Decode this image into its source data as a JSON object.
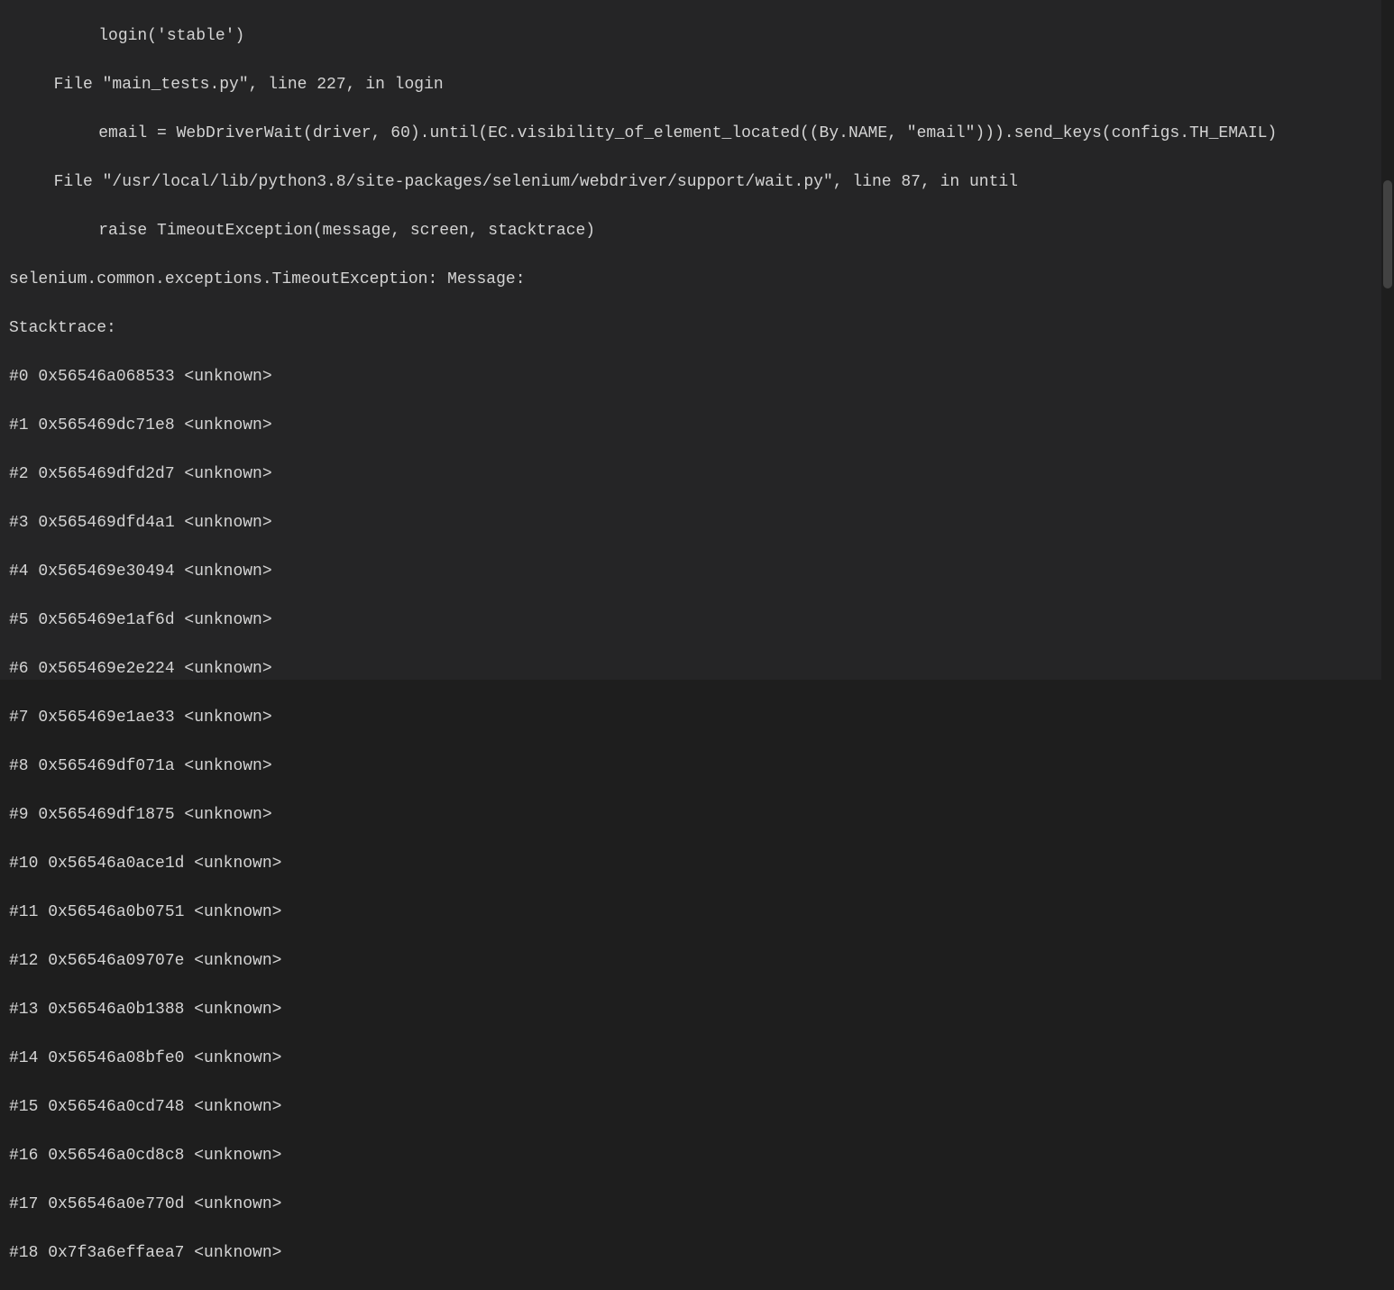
{
  "traceback": {
    "line0": "    login('stable')",
    "line1": "  File \"main_tests.py\", line 227, in login",
    "line2": "    email = WebDriverWait(driver, 60).until(EC.visibility_of_element_located((By.NAME, \"email\"))).send_keys(configs.TH_EMAIL)",
    "line3": "  File \"/usr/local/lib/python3.8/site-packages/selenium/webdriver/support/wait.py\", line 87, in until",
    "line4": "    raise TimeoutException(message, screen, stacktrace)",
    "line5": "selenium.common.exceptions.TimeoutException: Message:",
    "line6": "Stacktrace:",
    "frames": [
      "#0 0x56546a068533 <unknown>",
      "#1 0x565469dc71e8 <unknown>",
      "#2 0x565469dfd2d7 <unknown>",
      "#3 0x565469dfd4a1 <unknown>",
      "#4 0x565469e30494 <unknown>",
      "#5 0x565469e1af6d <unknown>",
      "#6 0x565469e2e224 <unknown>",
      "#7 0x565469e1ae33 <unknown>",
      "#8 0x565469df071a <unknown>",
      "#9 0x565469df1875 <unknown>",
      "#10 0x56546a0ace1d <unknown>",
      "#11 0x56546a0b0751 <unknown>",
      "#12 0x56546a09707e <unknown>",
      "#13 0x56546a0b1388 <unknown>",
      "#14 0x56546a08bfe0 <unknown>",
      "#15 0x56546a0cd748 <unknown>",
      "#16 0x56546a0cd8c8 <unknown>",
      "#17 0x56546a0e770d <unknown>",
      "#18 0x7f3a6effaea7 <unknown>"
    ]
  }
}
